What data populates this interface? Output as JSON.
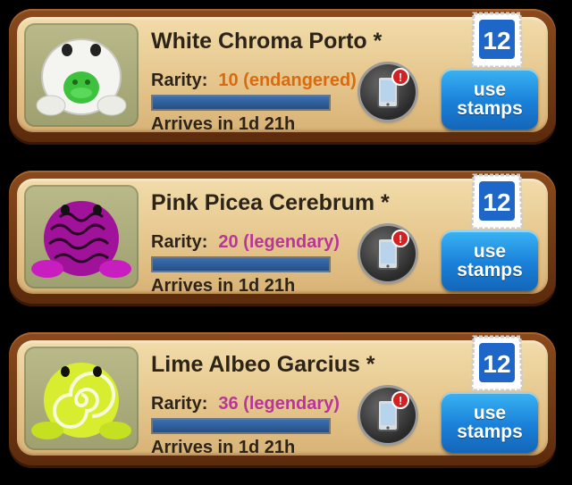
{
  "cards": [
    {
      "name": "White Chroma Porto *",
      "rarity_label": "Rarity:",
      "rarity_value": "10 (endangered)",
      "rarity_color": "#d96a10",
      "arrives": "Arrives in 1d 21h",
      "use_button": [
        "use",
        "stamps"
      ],
      "stamp_count": "12",
      "notification_badge": "!",
      "frog_icon": "white-green-frog-icon"
    },
    {
      "name": "Pink Picea Cerebrum *",
      "rarity_label": "Rarity:",
      "rarity_value": "20 (legendary)",
      "rarity_color": "#b8359a",
      "arrives": "Arrives in 1d 21h",
      "use_button": [
        "use",
        "stamps"
      ],
      "stamp_count": "12",
      "notification_badge": "!",
      "frog_icon": "magenta-brain-frog-icon"
    },
    {
      "name": "Lime Albeo Garcius *",
      "rarity_label": "Rarity:",
      "rarity_value": "36 (legendary)",
      "rarity_color": "#b8359a",
      "arrives": "Arrives in 1d 21h",
      "use_button": [
        "use",
        "stamps"
      ],
      "stamp_count": "12",
      "notification_badge": "!",
      "frog_icon": "lime-swirl-frog-icon"
    }
  ]
}
